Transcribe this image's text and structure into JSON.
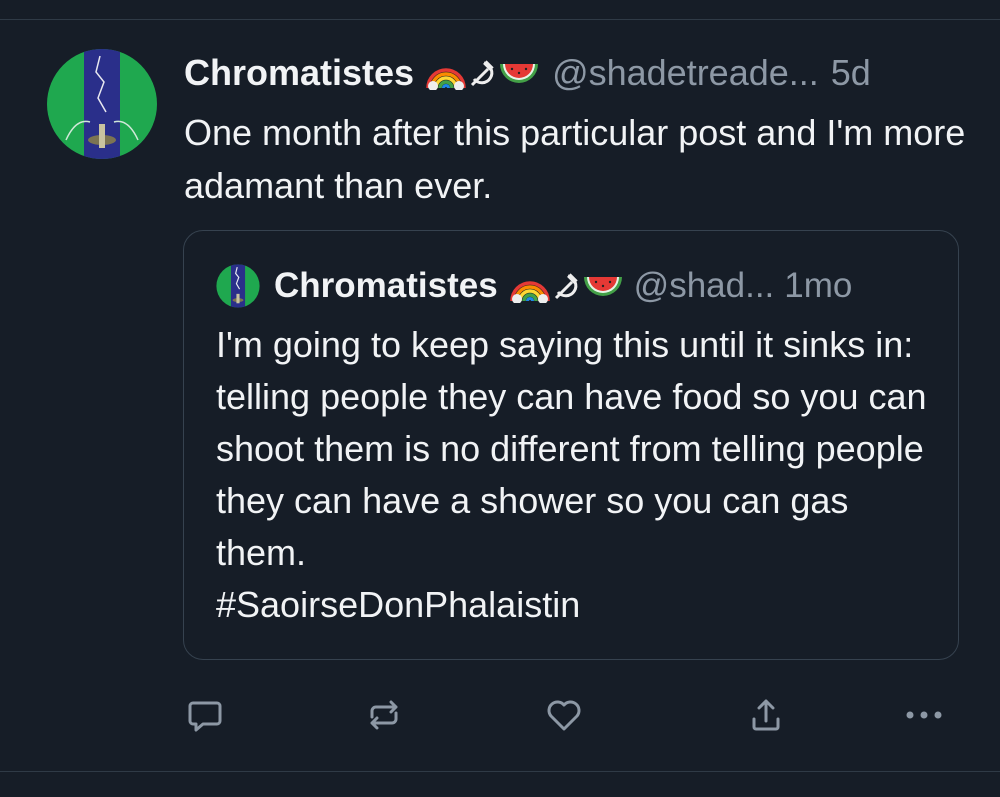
{
  "post": {
    "author": {
      "display_name": "Chromatistes",
      "handle": "@shadetreade...",
      "avatar_icon": "avatar-green-blue-icon",
      "emojis": [
        "rainbow",
        "hammer-and-sickle",
        "watermelon"
      ]
    },
    "timestamp": "5d",
    "text": "One month after this particular post and I'm more adamant than ever."
  },
  "quote": {
    "author": {
      "display_name": "Chromatistes",
      "handle": "@shad...",
      "avatar_icon": "avatar-green-blue-icon",
      "emojis": [
        "rainbow",
        "hammer-and-sickle",
        "watermelon"
      ]
    },
    "timestamp": "1mo",
    "text": "I'm going to keep saying this until it sinks in: telling people they can have food so you can shoot them is no different from telling people they can have a shower so you can gas them.",
    "hashtag": "#SaoirseDonPhalaistin"
  },
  "actions": [
    {
      "name": "reply",
      "icon": "comment-icon"
    },
    {
      "name": "repost",
      "icon": "repost-icon"
    },
    {
      "name": "like",
      "icon": "heart-icon"
    },
    {
      "name": "share",
      "icon": "share-icon"
    },
    {
      "name": "more",
      "icon": "more-icon"
    }
  ],
  "colors": {
    "background": "#161d27",
    "text": "#f1f3f5",
    "muted": "#8d98a5",
    "border": "#36424f",
    "icon": "#8d98a5"
  }
}
